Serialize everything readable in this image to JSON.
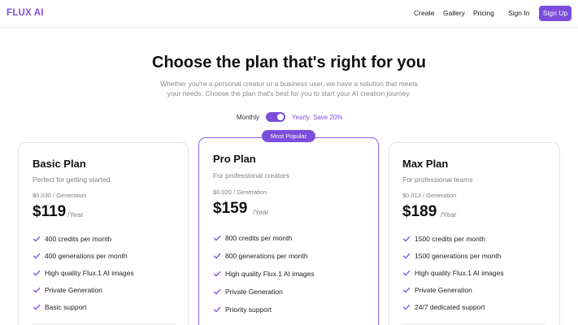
{
  "header": {
    "logo": "FLUX AI",
    "nav": [
      "Create",
      "Gallery",
      "Pricing"
    ],
    "sign_in": "Sign In",
    "sign_up": "Sign Up"
  },
  "hero": {
    "title": "Choose the plan that's right for you",
    "subtitle_line1": "Whether you're a personal creator or a business user, we have a solution that meets",
    "subtitle_line2": "your needs. Choose the plan that's best for you to start your AI creation journey."
  },
  "billing": {
    "monthly": "Monthly",
    "yearly": "Yearly",
    "save": "Save 20%",
    "yearly_selected": true
  },
  "colors": {
    "accent": "#7c4ddb"
  },
  "plans": [
    {
      "name": "Basic Plan",
      "description": "Perfect for getting started",
      "per_generation": "$0.030 / Generation",
      "price": "$119",
      "period": "/Year",
      "features": [
        "400 credits per month",
        "400 generations per month",
        "High quality Flux.1 AI images",
        "Private Generation",
        "Basic support"
      ]
    },
    {
      "name": "Pro Plan",
      "badge": "Most Popular",
      "description": "For professional creators",
      "per_generation": "$0.020 / Generation",
      "price": "$159",
      "period": "/Year",
      "features": [
        "800 credits per month",
        "800 generations per month",
        "High quality Flux.1 AI images",
        "Private Generation",
        "Priority support"
      ]
    },
    {
      "name": "Max Plan",
      "description": "For professional teams",
      "per_generation": "$0.013 / Generation",
      "price": "$189",
      "period": "/Year",
      "features": [
        "1500 credits per month",
        "1500 generations per month",
        "High quality Flux.1 AI images",
        "Private Generation",
        "24/7 dedicated support"
      ]
    }
  ]
}
